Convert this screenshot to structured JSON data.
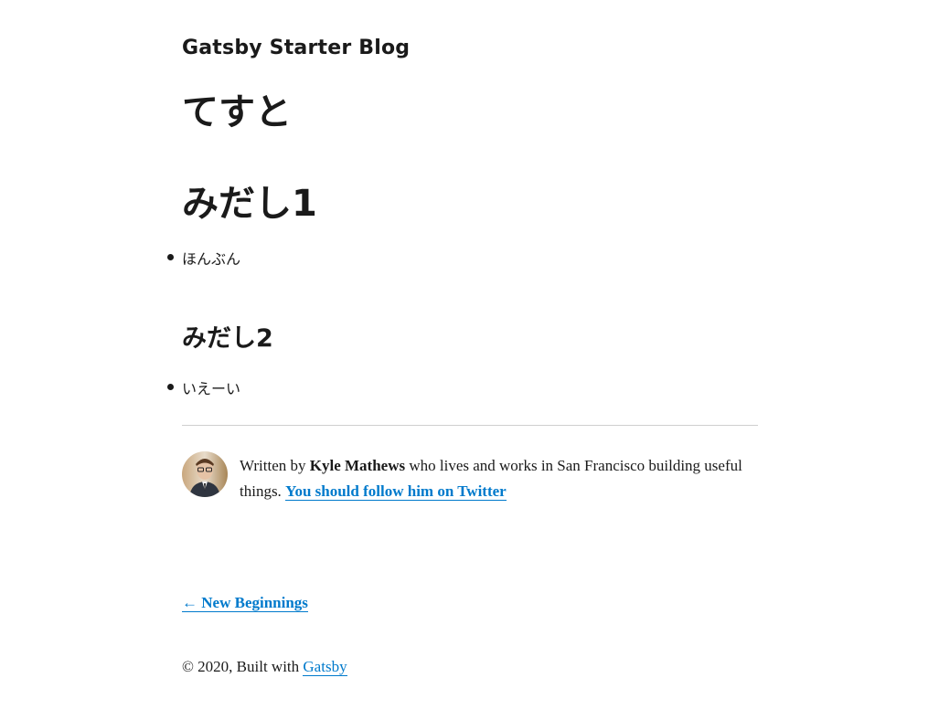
{
  "header": {
    "site_title": "Gatsby Starter Blog"
  },
  "post": {
    "title": "てすと",
    "sections": [
      {
        "heading": "みだし1",
        "items": [
          "ほんぶん"
        ]
      },
      {
        "heading": "みだし2",
        "items": [
          "いえーい"
        ]
      }
    ]
  },
  "bio": {
    "prefix": "Written by ",
    "author": "Kyle Mathews",
    "middle": " who lives and works in San Francisco building useful things. ",
    "twitter_link": "You should follow him on Twitter"
  },
  "nav": {
    "prev_link": "← New Beginnings"
  },
  "footer": {
    "copyright": "© 2020, Built with ",
    "link": "Gatsby"
  }
}
